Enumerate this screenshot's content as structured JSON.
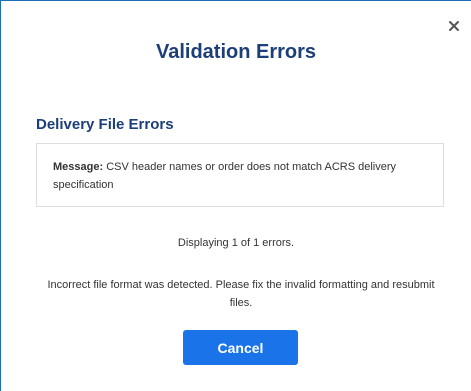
{
  "dialog": {
    "title": "Validation Errors",
    "close_icon": "close-icon"
  },
  "section": {
    "title": "Delivery File Errors"
  },
  "message": {
    "label": "Message:",
    "text": "CSV header names or order does not match ACRS delivery specification"
  },
  "summary": {
    "count_text": "Displaying 1 of 1 errors.",
    "info_text": "Incorrect file format was detected. Please fix the invalid formatting and resubmit files."
  },
  "actions": {
    "cancel_label": "Cancel"
  },
  "colors": {
    "title": "#1c3f7a",
    "button": "#1a73e8",
    "border": "#1b6fb8"
  }
}
